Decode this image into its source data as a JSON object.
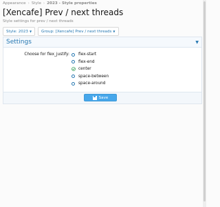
{
  "breadcrumb": {
    "items": [
      {
        "label": "Appearance",
        "current": false
      },
      {
        "label": "Style",
        "current": false
      },
      {
        "label": "2023 - Style properties",
        "current": true
      }
    ]
  },
  "page": {
    "title": "[Xencafe] Prev / next threads",
    "description": "Style settings for prev / next threads"
  },
  "filters": {
    "style_label": "Style: 2023",
    "group_label": "Group: [Xencafe] Prev / next threads"
  },
  "panel": {
    "title": "Settings",
    "field_label": "Choose for flex_justify:",
    "options": [
      {
        "label": "flex-start",
        "selected": false
      },
      {
        "label": "flex-end",
        "selected": false
      },
      {
        "label": "center",
        "selected": true
      },
      {
        "label": "space-between",
        "selected": false
      },
      {
        "label": "space-around",
        "selected": false
      }
    ],
    "save_label": "Save"
  },
  "colors": {
    "accent": "#2577b1",
    "button": "#47a7eb",
    "check": "#3aa05a"
  }
}
